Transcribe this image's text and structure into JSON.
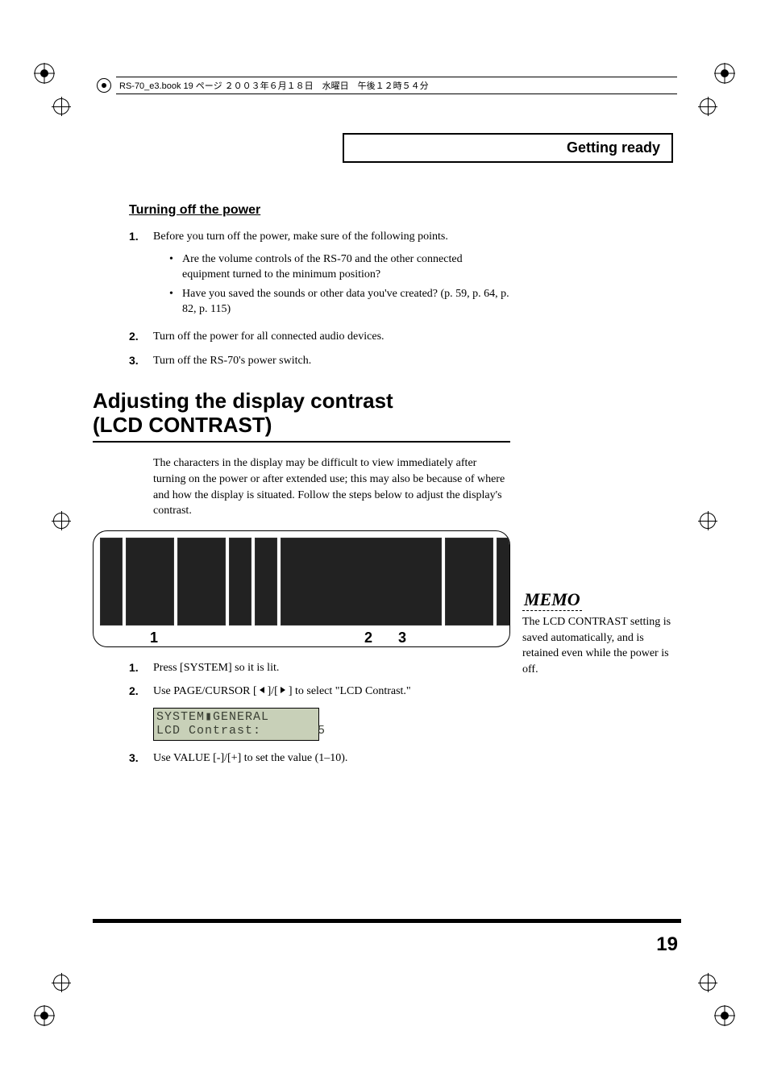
{
  "book_info": "RS-70_e3.book  19 ページ  ２００３年６月１８日　水曜日　午後１２時５４分",
  "header": {
    "title": "Getting ready"
  },
  "section1": {
    "heading": "Turning off the power",
    "items": [
      {
        "num": "1.",
        "text": "Before you turn off the power, make sure of the following points.",
        "sub": [
          "Are the volume controls of the RS-70 and the other connected equipment turned to the minimum position?",
          "Have you saved the sounds or other data you've created? (p. 59, p. 64, p. 82, p. 115)"
        ]
      },
      {
        "num": "2.",
        "text": "Turn off the power for all connected audio devices."
      },
      {
        "num": "3.",
        "text": "Turn off the RS-70's power switch."
      }
    ]
  },
  "section2": {
    "heading_line1": "Adjusting the display contrast",
    "heading_line2": "(LCD CONTRAST)",
    "intro": "The characters in the display may be difficult to view immediately after turning on the power or after extended use; this may also be because of where and how the display is situated. Follow the steps below to adjust the display's contrast.",
    "callouts": {
      "c1": "1",
      "c2": "2",
      "c3": "3"
    },
    "steps": [
      {
        "num": "1.",
        "prefix": "Press [SYSTEM] so it is lit."
      },
      {
        "num": "2.",
        "prefix": "Use PAGE/CURSOR [ ",
        "mid": " ]/[ ",
        "suffix": " ] to select \"LCD Contrast.\""
      },
      {
        "num": "3.",
        "prefix": "Use VALUE [-]/[+] to set the value (1–10)."
      }
    ],
    "lcd": {
      "line1": "SYSTEM▮GENERAL",
      "line2": "LCD Contrast:       5"
    }
  },
  "memo": {
    "label": "MEMO",
    "text": "The LCD CONTRAST setting is saved automatically, and is retained even while the power is off."
  },
  "page_number": "19"
}
